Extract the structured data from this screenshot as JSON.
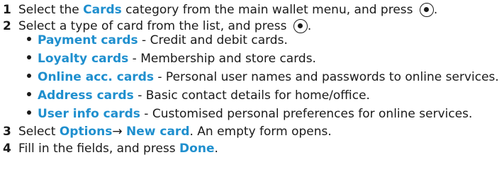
{
  "steps": [
    {
      "number": "1",
      "before": "Select the ",
      "keyword": "Cards",
      "after": " category from the main wallet menu, and press ",
      "end": "."
    },
    {
      "number": "2",
      "text": "Select a type of card from the list, and press ",
      "end": "."
    },
    {
      "number": "3",
      "before": "Select ",
      "keyword1": "Options",
      "arrow": "→",
      "keyword2": "New card",
      "after": ". An empty form opens."
    },
    {
      "number": "4",
      "before": "Fill in the fields, and press ",
      "keyword": "Done",
      "after": "."
    }
  ],
  "card_types": [
    {
      "name": "Payment cards",
      "description": " - Credit and debit cards."
    },
    {
      "name": "Loyalty cards",
      "description": " - Membership and store cards."
    },
    {
      "name": "Online acc. cards",
      "description": " - Personal user names and passwords to online services."
    },
    {
      "name": "Address cards",
      "description": " - Basic contact details for home/office."
    },
    {
      "name": "User info cards",
      "description": " - Customised personal preferences for online services."
    }
  ],
  "icons": {
    "select_key": "select-key-icon"
  },
  "colors": {
    "keyword": "#1f8fce",
    "text": "#1a1a1a"
  }
}
